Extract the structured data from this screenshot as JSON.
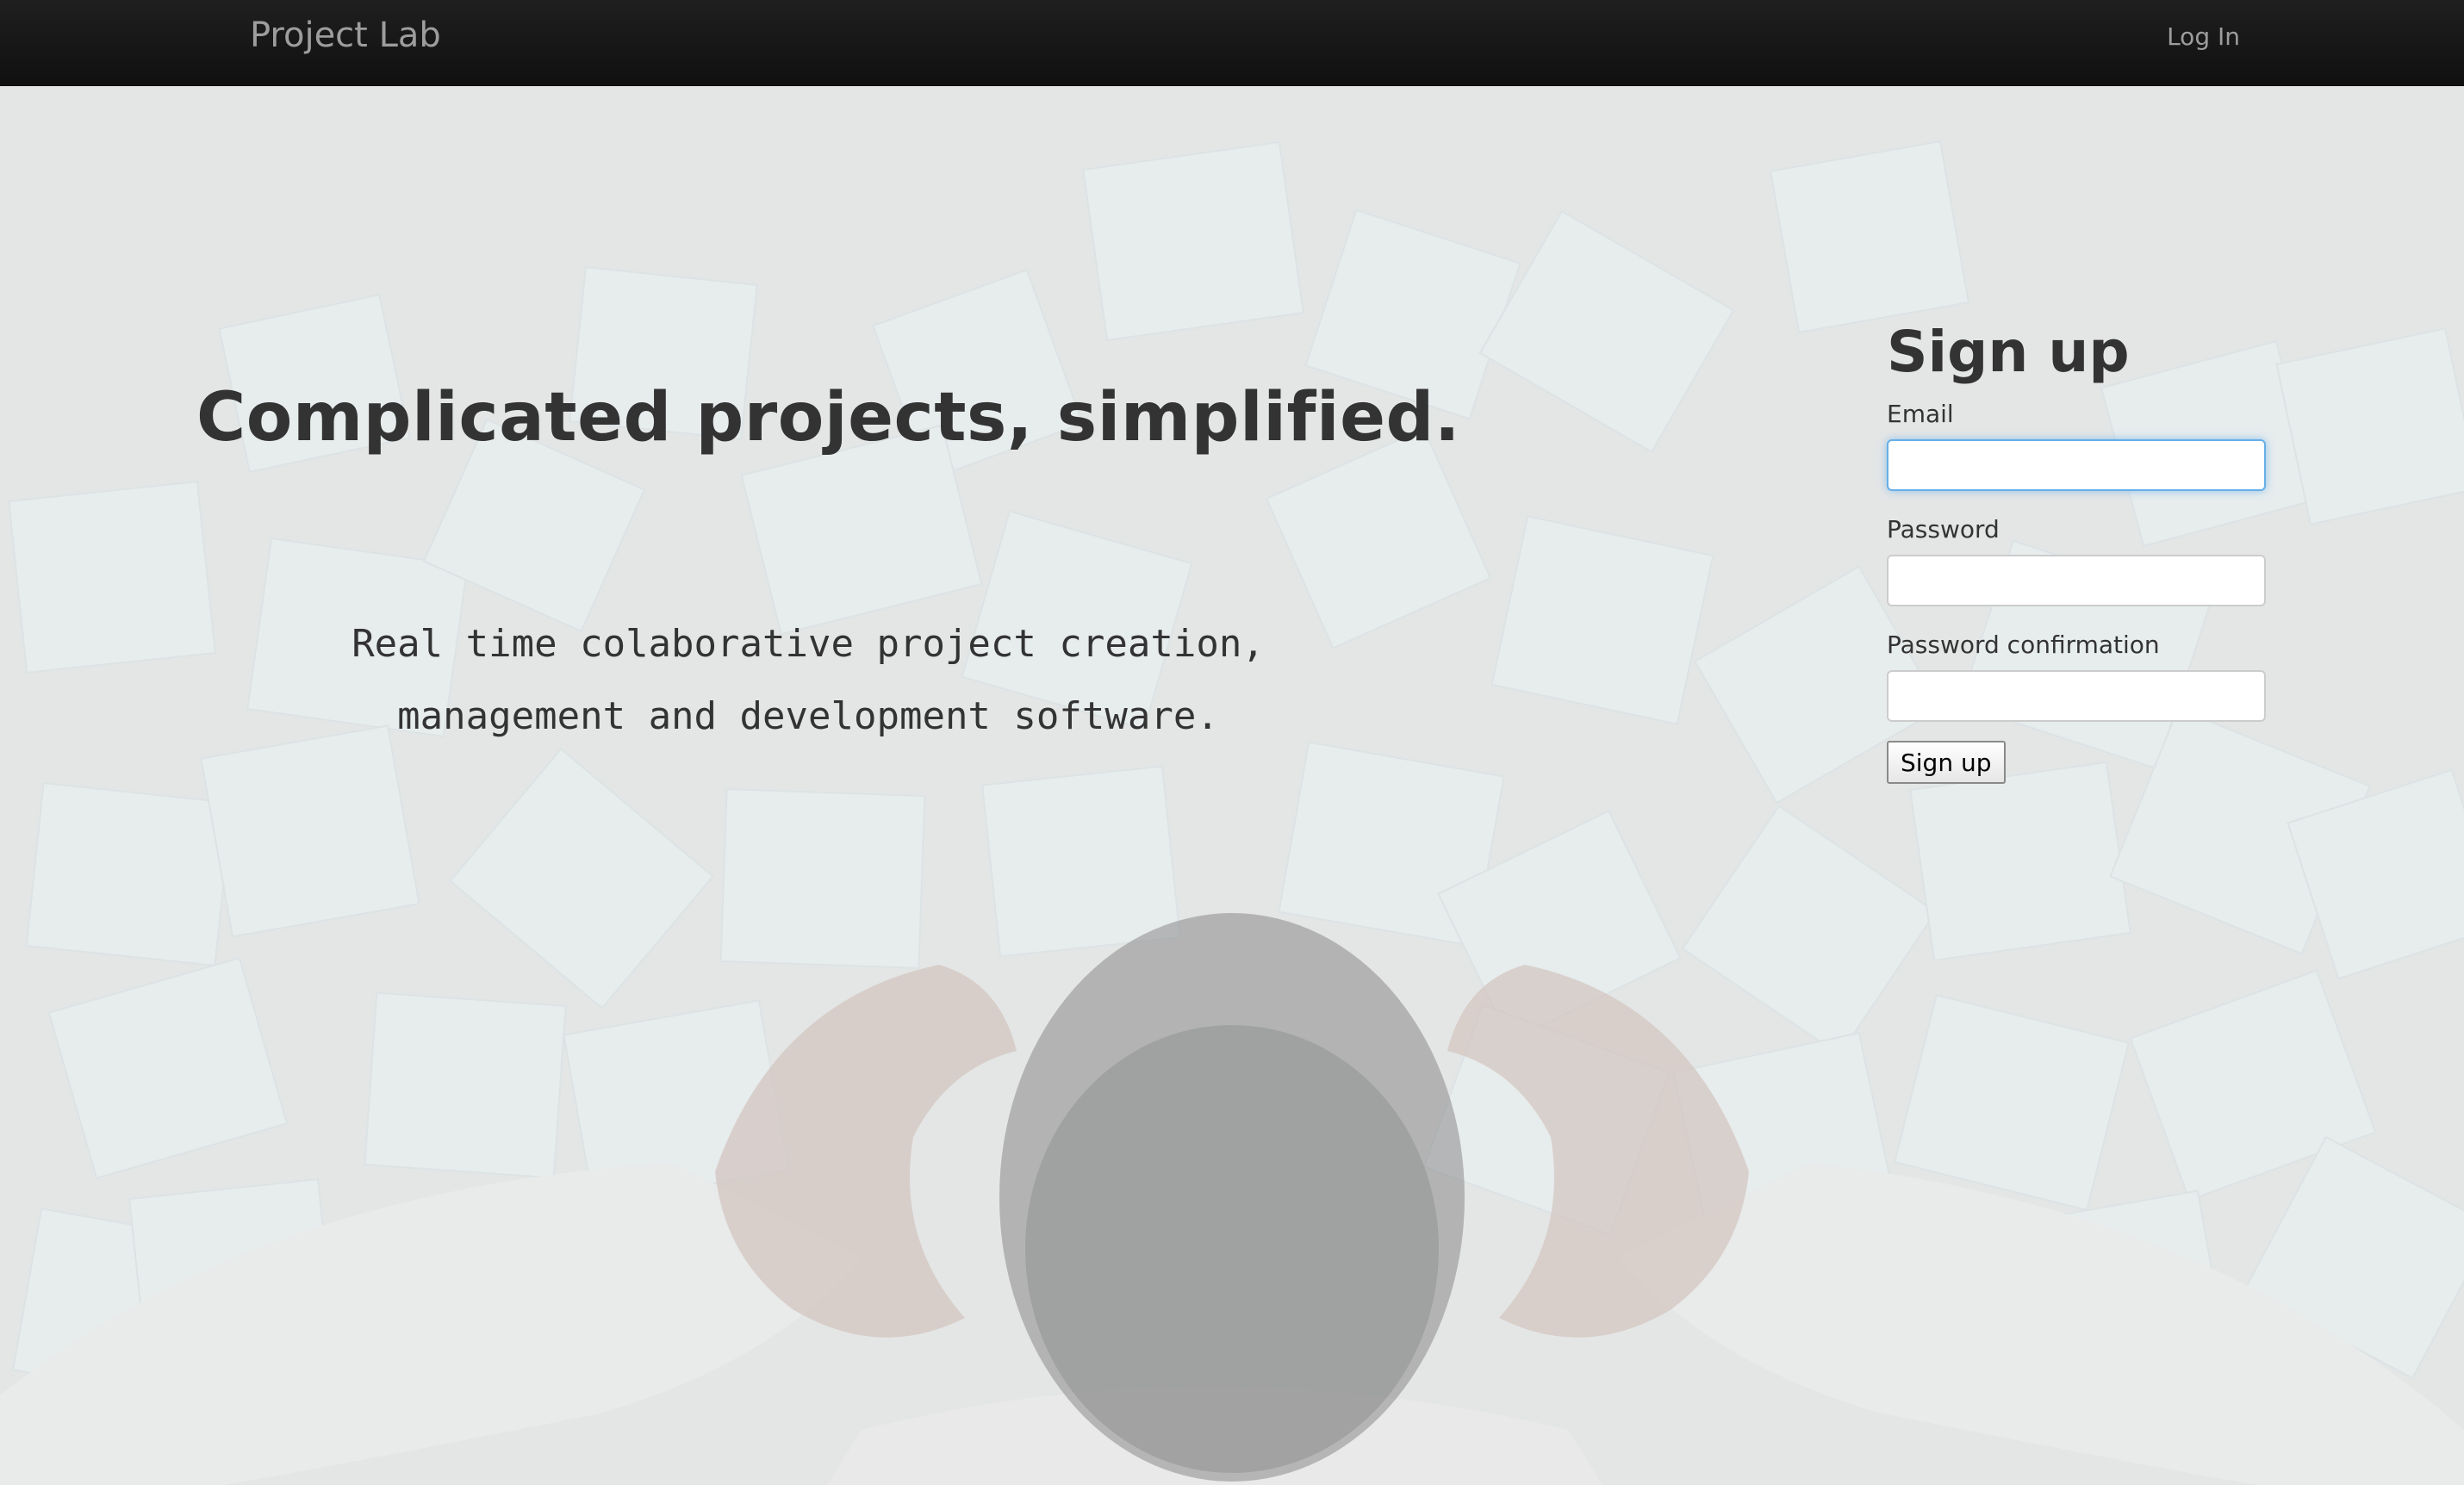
{
  "navbar": {
    "brand": "Project Lab",
    "login_label": "Log In"
  },
  "hero": {
    "headline": "Complicated projects, simplified.",
    "tagline_line1": "Real time colaborative project creation,",
    "tagline_line2": "management and development software."
  },
  "signup": {
    "title": "Sign up",
    "email_label": "Email",
    "email_value": "",
    "password_label": "Password",
    "password_value": "",
    "confirm_label": "Password confirmation",
    "confirm_value": "",
    "submit_label": "Sign up"
  },
  "colors": {
    "navbar_bg": "#141414",
    "nav_text": "#9d9d9d",
    "heading_text": "#333333",
    "focus_ring": "#66afe9",
    "sticky_note": "#e7f1f3",
    "background": "#e4e6e6"
  }
}
